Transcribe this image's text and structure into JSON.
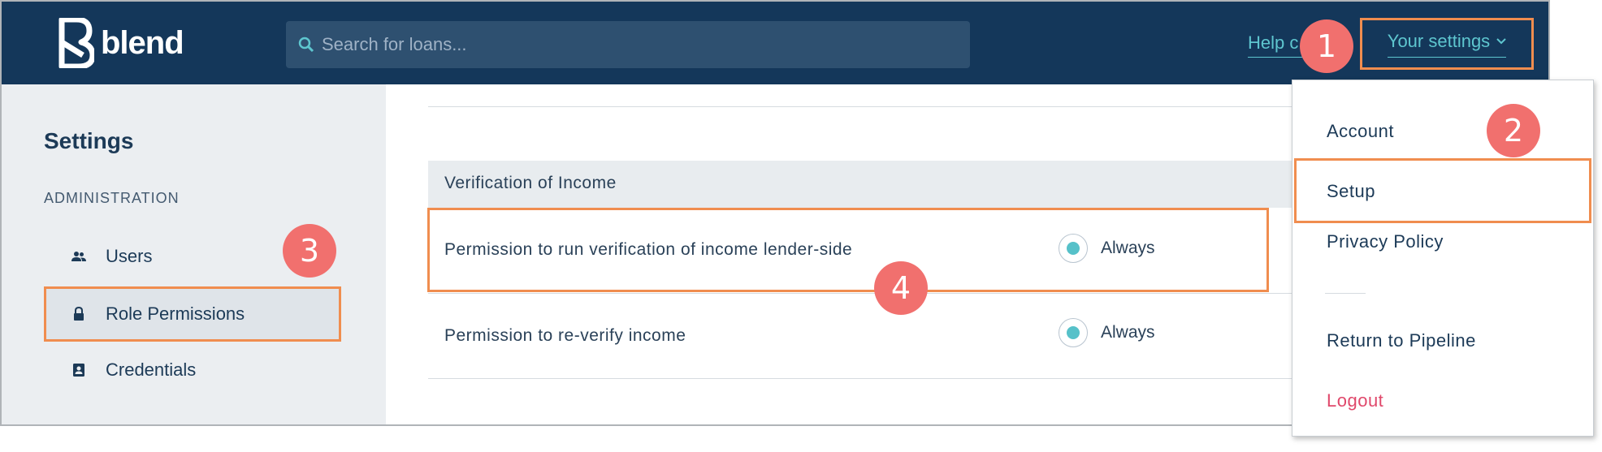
{
  "app": {
    "logo_text": "blend"
  },
  "header": {
    "search_placeholder": "Search for loans...",
    "help_link": "Help c",
    "settings_label": "Your settings"
  },
  "sidebar": {
    "title": "Settings",
    "section": "ADMINISTRATION",
    "items": [
      {
        "label": "Users",
        "icon": "users-icon"
      },
      {
        "label": "Role Permissions",
        "icon": "lock-icon",
        "active": true
      },
      {
        "label": "Credentials",
        "icon": "badge-icon"
      }
    ]
  },
  "main": {
    "section_title": "Verification of Income",
    "rows": [
      {
        "label": "Permission to run verification of income lender-side",
        "value": "Always"
      },
      {
        "label": "Permission to re-verify income",
        "value": "Always"
      }
    ]
  },
  "dropdown": {
    "items": [
      "Account",
      "Setup",
      "Privacy Policy",
      "Return to Pipeline",
      "Logout"
    ]
  },
  "annotations": [
    "1",
    "2",
    "3",
    "4"
  ],
  "colors": {
    "header_bg": "#14375a",
    "accent": "#5ec6cf",
    "highlight": "#f08d4f",
    "badge": "#f1706e",
    "logout": "#e0486b"
  }
}
